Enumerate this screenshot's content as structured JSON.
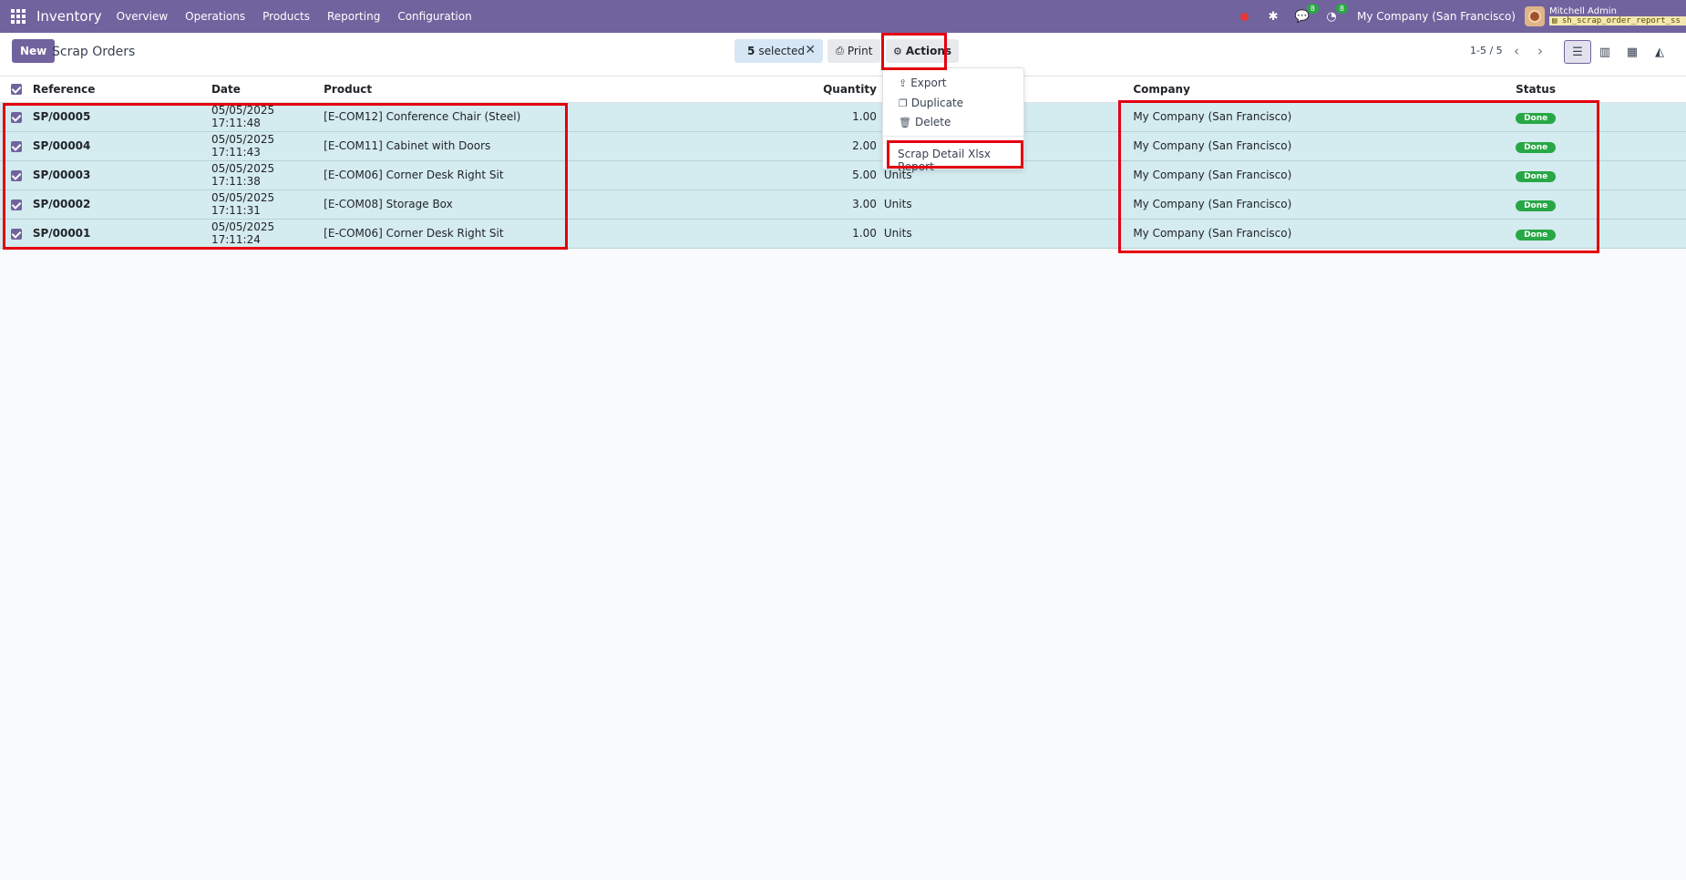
{
  "navbar": {
    "app_name": "Inventory",
    "menu": [
      "Overview",
      "Operations",
      "Products",
      "Reporting",
      "Configuration"
    ],
    "messages_count": "8",
    "activities_count": "8",
    "company": "My Company (San Francisco)",
    "user_name": "Mitchell Admin",
    "database": "sh_scrap_order_report_ss"
  },
  "control_panel": {
    "new_label": "New",
    "title": "Scrap Orders",
    "selected_count": "5",
    "selected_text": "selected",
    "print_label": "Print",
    "actions_label": "Actions",
    "pager": "1-5 / 5"
  },
  "actions_menu": {
    "export": "Export",
    "duplicate": "Duplicate",
    "delete": "Delete",
    "report": "Scrap Detail Xlsx Report"
  },
  "table": {
    "headers": {
      "reference": "Reference",
      "date": "Date",
      "product": "Product",
      "quantity": "Quantity",
      "uom": "U",
      "company": "Company",
      "status": "Status"
    },
    "rows": [
      {
        "reference": "SP/00005",
        "date": "05/05/2025 17:11:48",
        "product": "[E-COM12] Conference Chair (Steel)",
        "quantity": "1.00",
        "uom": "U",
        "company": "My Company (San Francisco)",
        "status": "Done"
      },
      {
        "reference": "SP/00004",
        "date": "05/05/2025 17:11:43",
        "product": "[E-COM11] Cabinet with Doors",
        "quantity": "2.00",
        "uom": "U",
        "company": "My Company (San Francisco)",
        "status": "Done"
      },
      {
        "reference": "SP/00003",
        "date": "05/05/2025 17:11:38",
        "product": "[E-COM06] Corner Desk Right Sit",
        "quantity": "5.00",
        "uom": "Units",
        "company": "My Company (San Francisco)",
        "status": "Done"
      },
      {
        "reference": "SP/00002",
        "date": "05/05/2025 17:11:31",
        "product": "[E-COM08] Storage Box",
        "quantity": "3.00",
        "uom": "Units",
        "company": "My Company (San Francisco)",
        "status": "Done"
      },
      {
        "reference": "SP/00001",
        "date": "05/05/2025 17:11:24",
        "product": "[E-COM06] Corner Desk Right Sit",
        "quantity": "1.00",
        "uom": "Units",
        "company": "My Company (San Francisco)",
        "status": "Done"
      }
    ]
  },
  "colors": {
    "brand": "#71639e",
    "selected_row": "#d4ebef",
    "done_badge": "#28a745",
    "highlight": "#e3000f"
  }
}
